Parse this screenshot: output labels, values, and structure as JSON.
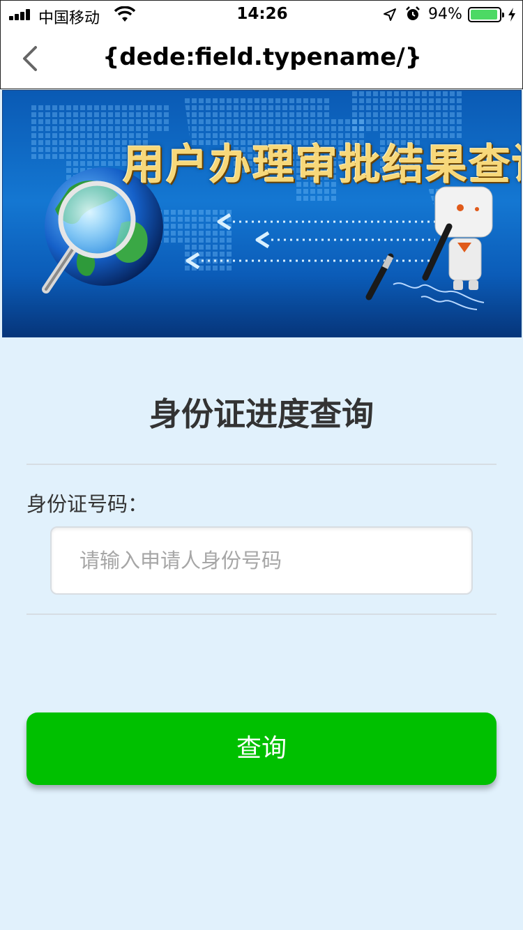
{
  "status_bar": {
    "carrier": "中国移动",
    "time": "14:26",
    "battery": "94%",
    "battery_level": 0.94,
    "icons": [
      "signal-icon",
      "wifi-icon",
      "location-icon",
      "alarm-icon",
      "battery-icon",
      "charging-icon"
    ]
  },
  "nav": {
    "back_icon": "chevron-left-icon",
    "title": "{dede:field.typename/}"
  },
  "banner": {
    "title": "用户办理审批结果查询",
    "icons": [
      "globe-icon",
      "magnifier-icon",
      "robot-icon",
      "pen-icon"
    ]
  },
  "form": {
    "title": "身份证进度查询",
    "id_label": "身份证号码：",
    "id_placeholder": "请输入申请人身份号码",
    "id_value": "",
    "submit_label": "查询"
  },
  "colors": {
    "background": "#e1f1fc",
    "button": "#00c000",
    "banner_blue": "#1477d2",
    "banner_title_gold": "#f7d87a"
  }
}
